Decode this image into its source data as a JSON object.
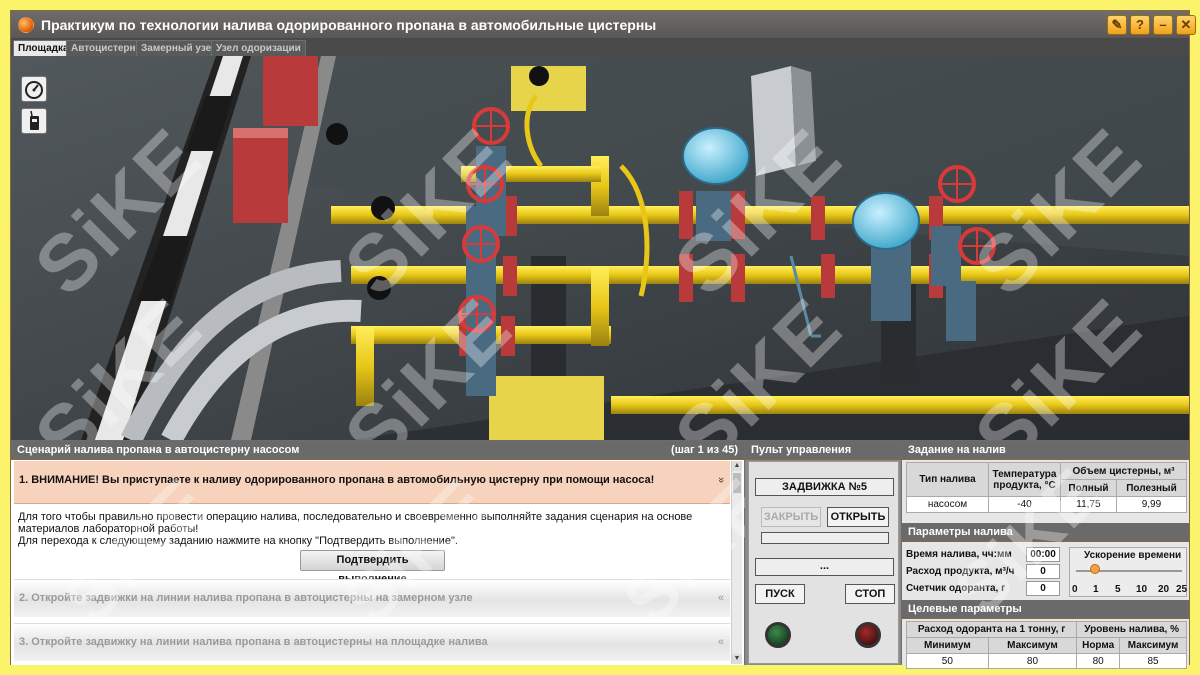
{
  "window": {
    "title": "Практикум по технологии налива одорированного пропана в автомобильные цистерны",
    "controls": [
      "✎",
      "?",
      "–",
      "✕"
    ]
  },
  "tabs": [
    {
      "label": "Площадка",
      "active": true
    },
    {
      "label": "Автоцистерна",
      "active": false
    },
    {
      "label": "Замерный узел",
      "active": false
    },
    {
      "label": "Узел одоризации",
      "active": false
    }
  ],
  "scene": {
    "watermark": "SiKE",
    "tools": [
      "speedometer-icon",
      "walkie-talkie-icon"
    ]
  },
  "scenario": {
    "header": "Сценарий налива пропана в автоцистерну насосом",
    "step_counter": "(шаг 1 из 45)",
    "step1_title": "1.  ВНИМАНИЕ! Вы приступаете к наливу одорированного пропана в автомобильную цистерну при помощи насоса!",
    "step1_text_1": "Для того чтобы правильно провести операцию налива, последовательно и своевременно выполняйте задания сценария на основе материалов лабораторной работы!",
    "step1_text_2": "Для перехода к следующему заданию нажмите на кнопку \"Подтвердить выполнение\".",
    "confirm_button": "Подтвердить выполнение",
    "step2_title": "2.  Откройте задвижки на линии налива пропана в автоцистерны на замерном узле",
    "step3_title": "3.  Откройте задвижку на линии налива пропана в автоцистерны на площадке налива",
    "chevron_open": "»",
    "chevron_closed": "«"
  },
  "control_panel": {
    "header": "Пульт управления",
    "device_name": "ЗАДВИЖКА №5",
    "close_button": "ЗАКРЫТЬ",
    "open_button": "ОТКРЫТЬ",
    "status_field": "...",
    "start_button": "ПУСК",
    "stop_button": "СТОП",
    "colors": {
      "lamp_green": "#1f5a2a",
      "lamp_red": "#6a1414"
    }
  },
  "task": {
    "header": "Задание на налив",
    "col_type": "Тип налива",
    "col_temp": "Температура продукта, °С",
    "col_volume": "Объем цистерны, м³",
    "col_full": "Полный",
    "col_useful": "Полезный",
    "row": {
      "type": "насосом",
      "temp": "-40",
      "full": "11,75",
      "useful": "9,99"
    }
  },
  "params": {
    "header": "Параметры налива",
    "time_label": "Время налива, чч:мм",
    "time_value": "00:00",
    "flow_label": "Расход продукта, м³/ч",
    "flow_value": "0",
    "odor_counter_label": "Счетчик одоранта, г",
    "odor_counter_value": "0",
    "speed_label": "Ускорение времени",
    "speed_ticks": [
      "0",
      "1",
      "5",
      "10",
      "20",
      "25"
    ],
    "speed_value": "1"
  },
  "targets": {
    "header": "Целевые параметры",
    "odor_header": "Расход одоранта на 1 тонну, г",
    "level_header": "Уровень налива, %",
    "min": "Минимум",
    "max": "Максимум",
    "norm": "Норма",
    "max2": "Максимум",
    "odor_min": "50",
    "odor_max": "80",
    "level_norm": "80",
    "level_max": "85"
  }
}
